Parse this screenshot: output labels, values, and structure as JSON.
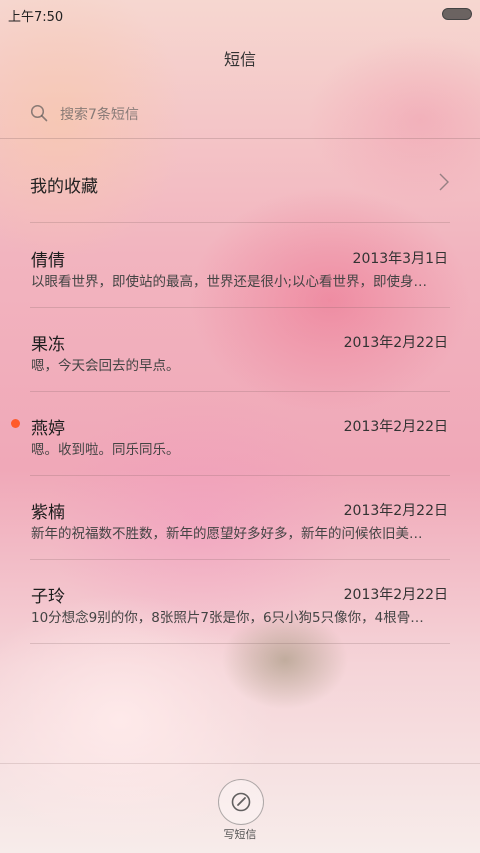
{
  "status_bar": {
    "time": "上午7:50"
  },
  "header": {
    "title": "短信"
  },
  "search": {
    "placeholder": "搜索7条短信"
  },
  "favorites": {
    "label": "我的收藏"
  },
  "conversations": [
    {
      "name": "倩倩",
      "date": "2013年3月1日",
      "preview": "以眼看世界，即使站的最高，世界还是很小;以心看世界，即使身…",
      "unread": false
    },
    {
      "name": "果冻",
      "date": "2013年2月22日",
      "preview": "嗯，今天会回去的早点。",
      "unread": false
    },
    {
      "name": "燕婷",
      "date": "2013年2月22日",
      "preview": "嗯。收到啦。同乐同乐。",
      "unread": true
    },
    {
      "name": "紫楠",
      "date": "2013年2月22日",
      "preview": "新年的祝福数不胜数，新年的愿望好多好多，新年的问候依旧美…",
      "unread": false
    },
    {
      "name": "子玲",
      "date": "2013年2月22日",
      "preview": "10分想念9别的你，8张照片7张是你，6只小狗5只像你，4根骨…",
      "unread": false
    }
  ],
  "compose": {
    "label": "写短信"
  },
  "colors": {
    "unread_dot": "#ff5a2a"
  }
}
